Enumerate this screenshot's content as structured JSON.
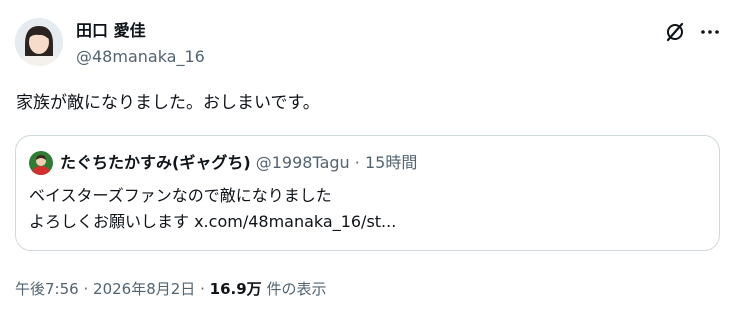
{
  "author": {
    "name": "田口 愛佳",
    "handle": "@48manaka_16"
  },
  "icons": {
    "grok": "grok-icon",
    "more": "more-icon"
  },
  "tweet": {
    "text": "家族が敵になりました。おしまいです。"
  },
  "quote": {
    "name": "たぐちたかすみ(ギャグち)",
    "handle": "@1998Tagu",
    "separator": "·",
    "time": "15時間",
    "line1": "ベイスターズファンなので敵になりました",
    "line2": "よろしくお願いします x.com/48manaka_16/st..."
  },
  "footer": {
    "time": "午後7:56",
    "separator1": "·",
    "date": "2026年8月2日",
    "separator2": "·",
    "views_count": "16.9万",
    "views_label": "件の表示"
  },
  "colors": {
    "text_primary": "#0f1419",
    "text_secondary": "#536471",
    "border": "#cfd9de",
    "quote_avatar_bg": "#2e7d32",
    "quote_avatar_shirt": "#d32f2f"
  }
}
